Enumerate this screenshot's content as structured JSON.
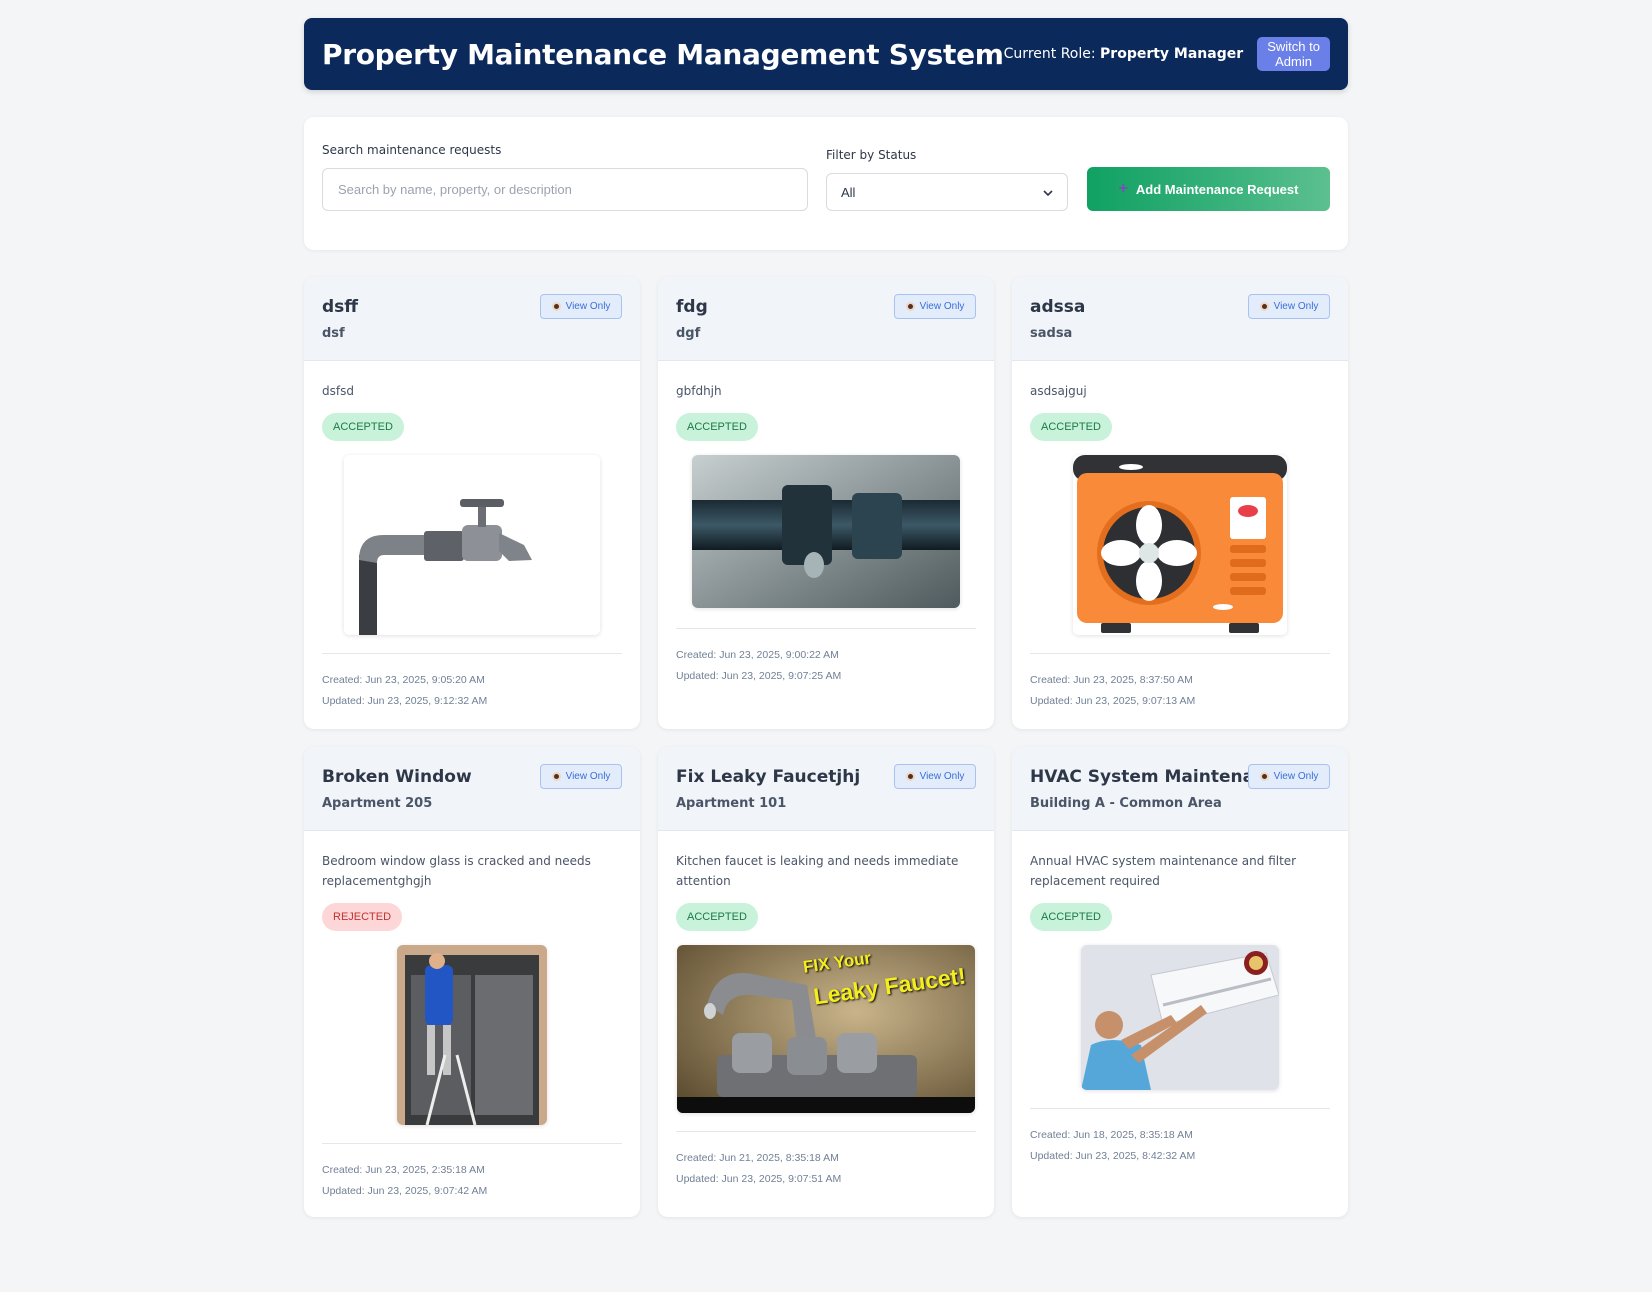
{
  "header": {
    "title": "Property Maintenance Management System",
    "role_label": "Current Role:",
    "role_value": "Property Manager",
    "switch_label": "Switch to Admin"
  },
  "filters": {
    "search_label": "Search maintenance requests",
    "search_placeholder": "Search by name, property, or description",
    "search_value": "",
    "status_label": "Filter by Status",
    "status_value": "All",
    "add_label": "Add Maintenance Request"
  },
  "colors": {
    "header_bg": "#0b2a5b",
    "accent": "#6b7fe8",
    "add_green": "#10a163",
    "accepted": "#1c7a47",
    "rejected": "#c53030"
  },
  "cards": [
    {
      "title": "dsff",
      "property": "dsf",
      "description": "dsfsd",
      "status": "ACCEPTED",
      "badge": "View Only",
      "image": "faucet-icon",
      "created": "Created: Jun 23, 2025, 9:05:20 AM",
      "updated": "Updated: Jun 23, 2025, 9:12:32 AM"
    },
    {
      "title": "fdg",
      "property": "dgf",
      "description": "gbfdhjh",
      "status": "ACCEPTED",
      "badge": "View Only",
      "image": "pipe-leak-photo",
      "created": "Created: Jun 23, 2025, 9:00:22 AM",
      "updated": "Updated: Jun 23, 2025, 9:07:25 AM"
    },
    {
      "title": "adssa",
      "property": "sadsa",
      "description": "asdsajguj",
      "status": "ACCEPTED",
      "badge": "View Only",
      "image": "ac-unit-icon",
      "created": "Created: Jun 23, 2025, 8:37:50 AM",
      "updated": "Updated: Jun 23, 2025, 9:07:13 AM"
    },
    {
      "title": "Broken Window",
      "property": "Apartment 205",
      "description": "Bedroom window glass is cracked and needs replacementghgjh",
      "status": "REJECTED",
      "badge": "View Only",
      "image": "window-repair-photo",
      "created": "Created: Jun 23, 2025, 2:35:18 AM",
      "updated": "Updated: Jun 23, 2025, 9:07:42 AM"
    },
    {
      "title": "Fix Leaky Faucetjhj",
      "property": "Apartment 101",
      "description": "Kitchen faucet is leaking and needs immediate attention",
      "status": "ACCEPTED",
      "badge": "View Only",
      "image": "leaky-faucet-photo",
      "image_text_1": "FIX Your",
      "image_text_2": "Leaky Faucet!",
      "created": "Created: Jun 21, 2025, 8:35:18 AM",
      "updated": "Updated: Jun 23, 2025, 9:07:51 AM"
    },
    {
      "title": "HVAC System Maintenance",
      "property": "Building A - Common Area",
      "description": "Annual HVAC system maintenance and filter replacement required",
      "status": "ACCEPTED",
      "badge": "View Only",
      "image": "hvac-service-photo",
      "created": "Created: Jun 18, 2025, 8:35:18 AM",
      "updated": "Updated: Jun 23, 2025, 8:42:32 AM"
    }
  ]
}
